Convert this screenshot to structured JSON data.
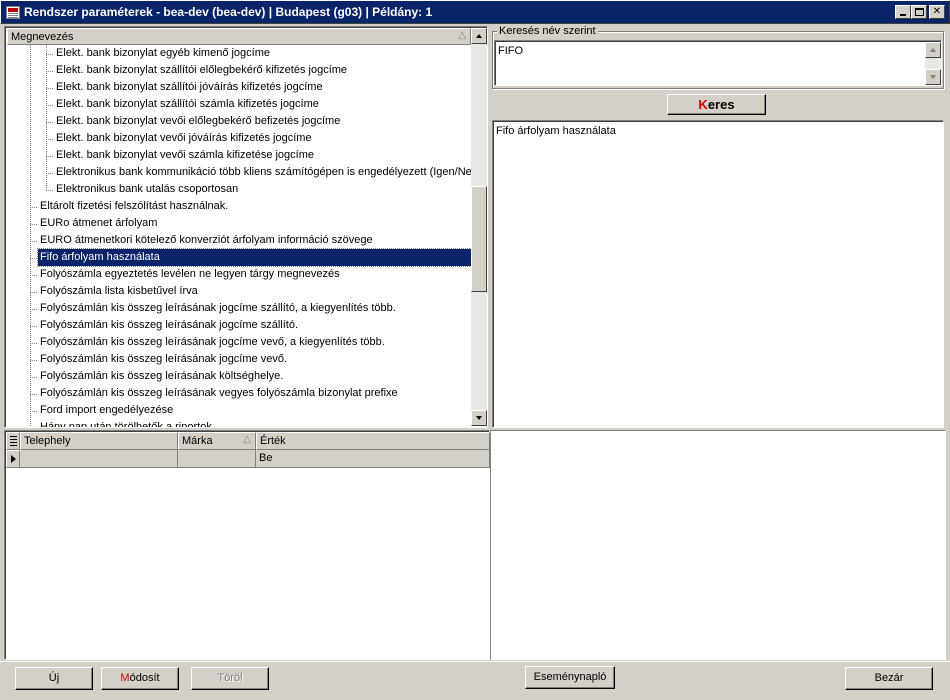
{
  "window": {
    "title": "Rendszer paraméterek - bea-dev (bea-dev) | Budapest (g03) | Példány: 1"
  },
  "tree": {
    "column_header": "Megnevezés",
    "sort_glyph": "△",
    "rows": [
      {
        "label": "Elekt. bank bizonylat egyéb kimenő jogcíme",
        "level": 2
      },
      {
        "label": "Elekt. bank bizonylat szállítói előlegbekérő kifizetés jogcíme",
        "level": 2
      },
      {
        "label": "Elekt. bank bizonylat szállítói jóváírás kifizetés jogcíme",
        "level": 2
      },
      {
        "label": "Elekt. bank bizonylat szállítói számla kifizetés jogcíme",
        "level": 2
      },
      {
        "label": "Elekt. bank bizonylat vevői előlegbekérő befizetés jogcíme",
        "level": 2
      },
      {
        "label": "Elekt. bank bizonylat vevői jóváírás kifizetés jogcíme",
        "level": 2
      },
      {
        "label": "Elekt. bank bizonylat vevői számla kifizetése jogcíme",
        "level": 2
      },
      {
        "label": "Elektronikus bank kommunikáció több kliens számítógépen is engedélyezett (Igen/Nem)",
        "level": 2
      },
      {
        "label": "Elektronikus bank utalás csoportosan",
        "level": 2
      },
      {
        "label": "Eltárolt fizetési felszólítást használnak.",
        "level": 1
      },
      {
        "label": "EURo átmenet árfolyam",
        "level": 1
      },
      {
        "label": "EURO átmenetkori kötelező konverziót árfolyam információ szövege",
        "level": 1
      },
      {
        "label": "Fifo árfolyam használata",
        "level": 1,
        "selected": true
      },
      {
        "label": "Folyószámla egyeztetés levélen ne legyen tárgy megnevezés",
        "level": 1
      },
      {
        "label": "Folyószámla lista kisbetűvel írva",
        "level": 1
      },
      {
        "label": "Folyószámlán kis összeg leírásának jogcíme szállító, a kiegyenlítés több.",
        "level": 1
      },
      {
        "label": "Folyószámlán kis összeg leírásának jogcíme szállító.",
        "level": 1
      },
      {
        "label": "Folyószámlán kis összeg leírásának jogcíme vevő, a kiegyenlítés több.",
        "level": 1
      },
      {
        "label": "Folyószámlán kis összeg leírásának jogcíme vevő.",
        "level": 1
      },
      {
        "label": "Folyószámlán kis összeg leírásának költséghelye.",
        "level": 1
      },
      {
        "label": "Folyószámlán kis összeg leírásának vegyes folyószámla bizonylat prefixe",
        "level": 1
      },
      {
        "label": "Ford import engedélyezése",
        "level": 1
      },
      {
        "label": "Hány nap után törölhetők a riportok",
        "level": 1
      }
    ]
  },
  "search": {
    "group_label": "Keresés név szerint",
    "query": "FIFO",
    "button_accel": "K",
    "button_rest": "eres",
    "results": [
      "Fifo árfolyam használata"
    ]
  },
  "grid": {
    "columns": [
      {
        "label": "Telephely",
        "sort": ""
      },
      {
        "label": "Márka",
        "sort": "△"
      },
      {
        "label": "Érték",
        "sort": ""
      }
    ],
    "row": {
      "telephely": "",
      "marka": "",
      "ertek": "Be"
    }
  },
  "buttons": {
    "new": "Új",
    "modify_accel": "M",
    "modify_rest": "ódosít",
    "delete": "Töröl",
    "eventlog": "Eseménynapló",
    "close": "Bezár"
  }
}
